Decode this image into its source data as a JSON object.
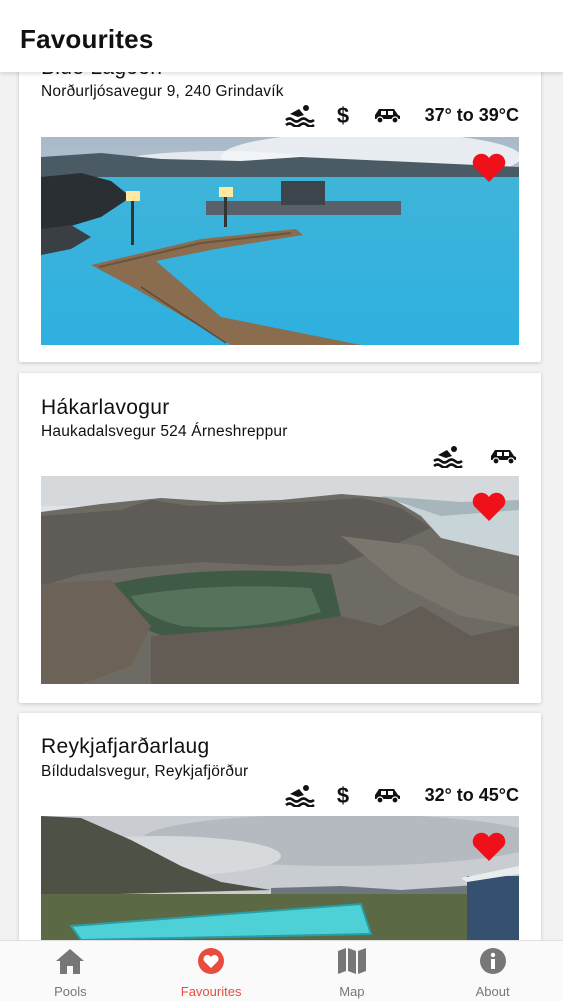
{
  "header": {
    "title": "Favourites"
  },
  "pools": [
    {
      "name": "Blue Lagoon",
      "address": "Norðurljósavegur 9, 240 Grindavík",
      "amenities": [
        "swimming-icon",
        "dollar-icon",
        "car-icon"
      ],
      "temperature": "37° to 39°C",
      "favourite": true
    },
    {
      "name": "Hákarlavogur",
      "address": "Haukadalsvegur 524 Árneshreppur",
      "amenities": [
        "swimming-icon",
        "car-icon"
      ],
      "temperature": "",
      "favourite": true
    },
    {
      "name": "Reykjafjarðarlaug",
      "address": "Bíldudalsvegur, Reykjafjörður",
      "amenities": [
        "swimming-icon",
        "dollar-icon",
        "car-icon"
      ],
      "temperature": "32° to 45°C",
      "favourite": true
    }
  ],
  "tabs": [
    {
      "label": "Pools",
      "icon": "home-icon",
      "active": false
    },
    {
      "label": "Favourites",
      "icon": "heart-icon",
      "active": true
    },
    {
      "label": "Map",
      "icon": "map-icon",
      "active": false
    },
    {
      "label": "About",
      "icon": "info-icon",
      "active": false
    }
  ],
  "colors": {
    "accent": "#e74c3c",
    "heart": "#f0101a",
    "inactive": "#777777"
  }
}
